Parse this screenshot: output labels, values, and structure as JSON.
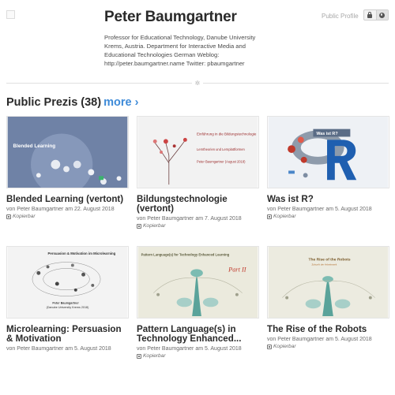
{
  "profile": {
    "name": "Peter Baumgartner",
    "bio": "Professor for Educational Technology, Danube University Krems, Austria. Department for Interactive Media and Educational Technologies German Weblog: http://peter.baumgartner.name Twitter: pbaumgartner"
  },
  "visibility": {
    "label": "Public Profile",
    "icons": [
      "lock-icon",
      "globe-icon"
    ],
    "selected": "globe-icon"
  },
  "divider_glyph": "✲",
  "section": {
    "title": "Public Prezis (38)",
    "more_label": "more ›"
  },
  "colors": {
    "accent": "#3d8ad8",
    "title": "#2a2a2a",
    "meta": "#6a6a6a"
  },
  "prezis": [
    {
      "title": "Blended Learning (vertont)",
      "meta": "von Peter Baumgartner am 22. August 2018",
      "copy_label": "Kopierbar",
      "thumb": {
        "heading": "Blended Learning",
        "lines": []
      }
    },
    {
      "title": "Bildungstechnologie (vertont)",
      "meta": "von Peter Baumgartner am 7. August 2018",
      "copy_label": "Kopierbar",
      "thumb": {
        "heading": "Einführung in die Bildungstechnologie",
        "lines": [
          "Lerntheorien und Lernplattformen",
          "Peter Baumgartner (August 2018)"
        ]
      }
    },
    {
      "title": "Was ist R?",
      "meta": "von Peter Baumgartner am 5. August 2018",
      "copy_label": "Kopierbar",
      "thumb": {
        "heading": "Was ist R?",
        "lines": []
      }
    },
    {
      "title": "Microlearning: Persuasion & Motivation",
      "meta": "von Peter Baumgartner am 5. August 2018",
      "copy_label": "",
      "thumb": {
        "heading": "Persuasion & Motivation im Microlearning",
        "lines": [
          "Peter Baumgartner",
          "(Danube University Krems 2018)"
        ]
      }
    },
    {
      "title": "Pattern Language(s) in Technology Enhanced...",
      "meta": "von Peter Baumgartner am 5. August 2018",
      "copy_label": "Kopierbar",
      "thumb": {
        "heading": "Pattern Language(s) for Technology Enhanced Learning",
        "lines": [
          "Part II"
        ]
      }
    },
    {
      "title": "The Rise of the Robots",
      "meta": "von Peter Baumgartner am 5. August 2018",
      "copy_label": "Kopierbar",
      "thumb": {
        "heading": "The Rise of the Robots",
        "lines": [
          "Zukunft der Arbeitswelt"
        ]
      }
    }
  ]
}
